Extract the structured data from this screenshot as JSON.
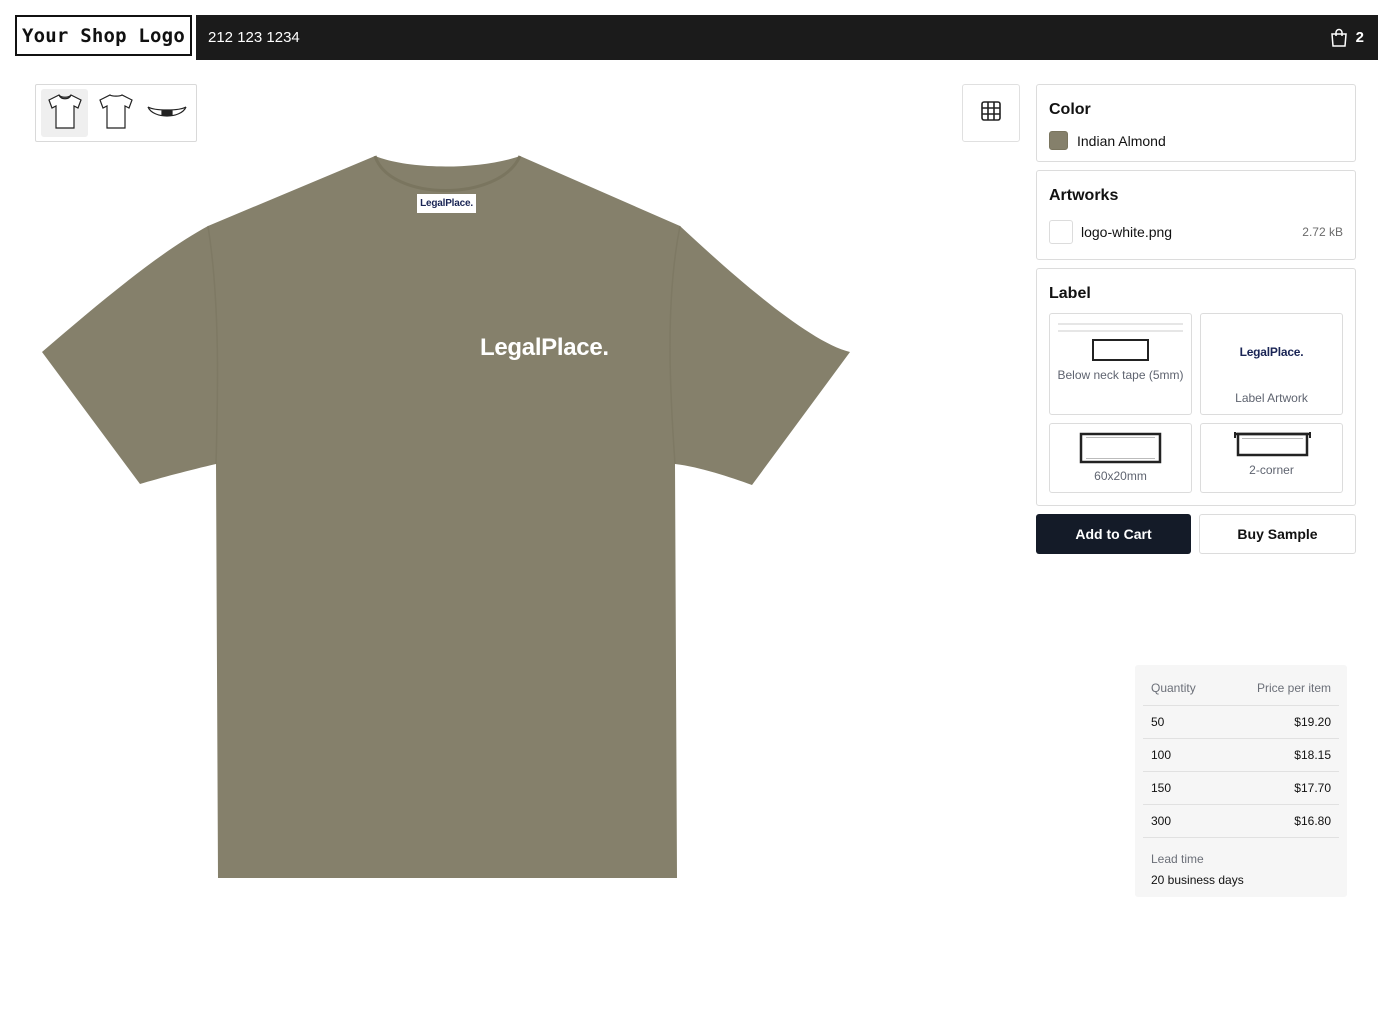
{
  "header": {
    "logo_text": "Your Shop Logo",
    "phone": "212 123 1234",
    "cart_count": "2"
  },
  "product": {
    "chest_print_text": "LegalPlace.",
    "neck_label_text": "LegalPlace."
  },
  "color": {
    "heading": "Color",
    "selected_name": "Indian Almond",
    "selected_hex": "#85806b"
  },
  "artworks": {
    "heading": "Artworks",
    "items": [
      {
        "name": "logo-white.png",
        "size": "2.72 kB"
      }
    ]
  },
  "label": {
    "heading": "Label",
    "options": [
      {
        "caption": "Below neck tape (5mm)"
      },
      {
        "caption": "Label Artwork",
        "artwork_text": "LegalPlace."
      },
      {
        "caption": "60x20mm"
      },
      {
        "caption": "2-corner"
      }
    ]
  },
  "actions": {
    "add_to_cart": "Add to Cart",
    "buy_sample": "Buy Sample"
  },
  "pricing": {
    "col_quantity": "Quantity",
    "col_price": "Price per item",
    "rows": [
      {
        "qty": "50",
        "price": "$19.20"
      },
      {
        "qty": "100",
        "price": "$18.15"
      },
      {
        "qty": "150",
        "price": "$17.70"
      },
      {
        "qty": "300",
        "price": "$16.80"
      }
    ],
    "lead_time_label": "Lead time",
    "lead_time_value": "20 business days"
  },
  "icons": {
    "cart": "shopping-bag-icon",
    "grid": "grid-icon",
    "views": [
      "tshirt-front-icon",
      "tshirt-back-icon",
      "neck-label-icon"
    ]
  }
}
